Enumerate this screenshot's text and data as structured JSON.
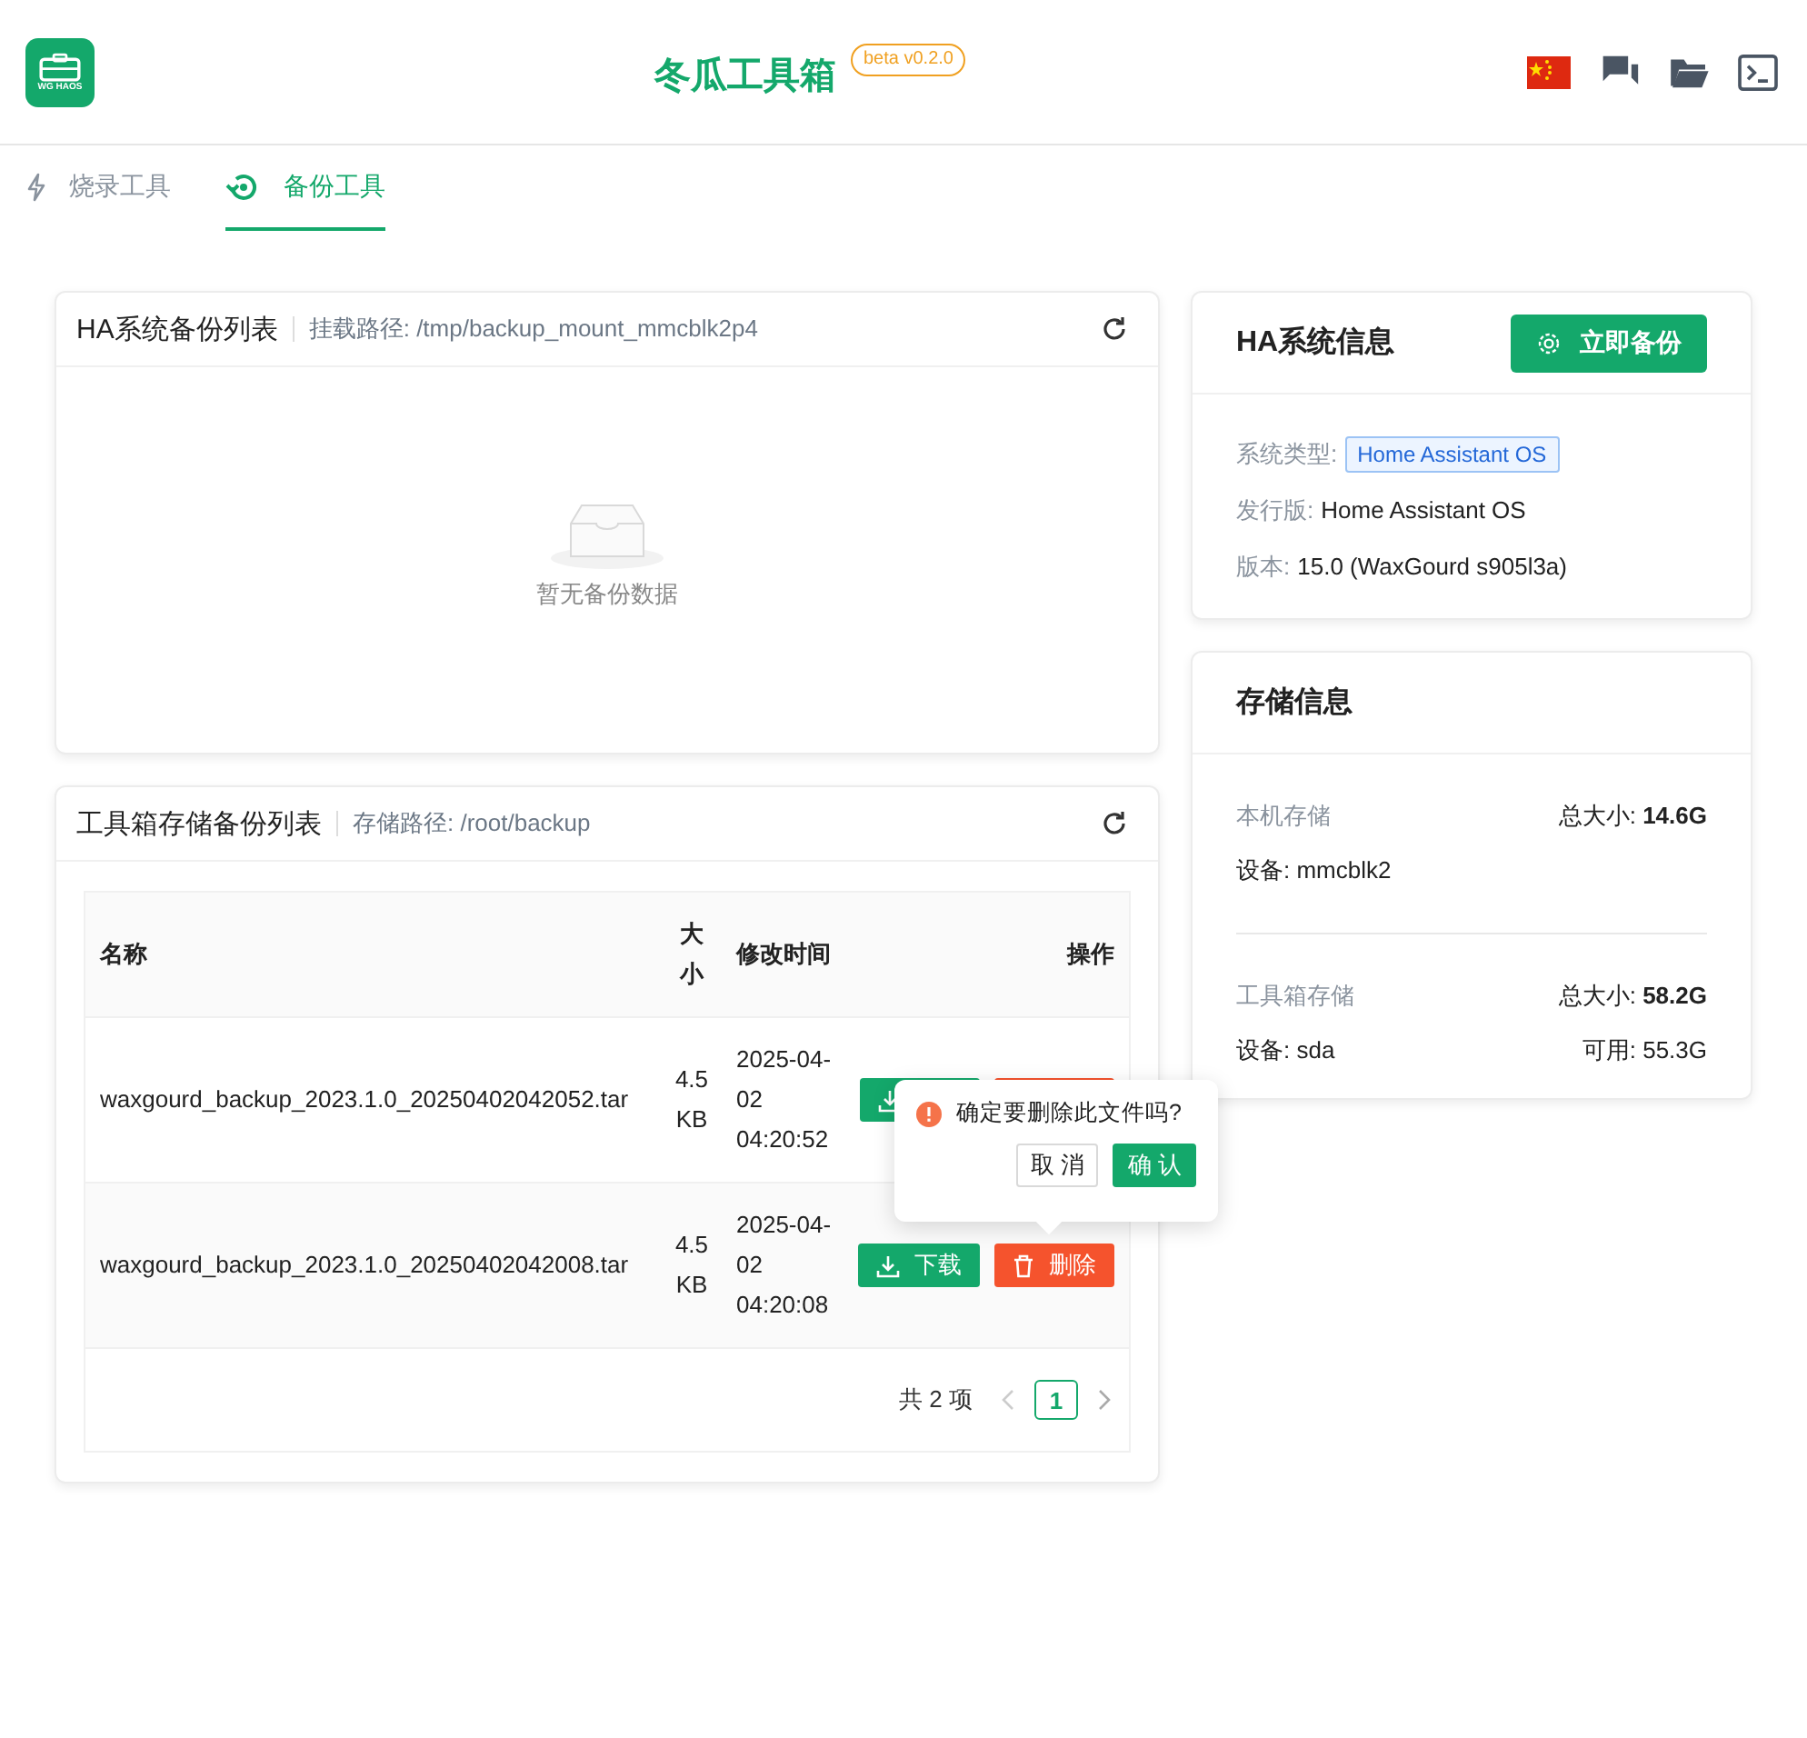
{
  "header": {
    "logo_text": "WG HAOS",
    "title": "冬瓜工具箱",
    "badge": "beta v0.2.0"
  },
  "tabs": [
    {
      "label": "烧录工具",
      "kind": "flash",
      "selected": false
    },
    {
      "label": "备份工具",
      "kind": "backup",
      "selected": true
    }
  ],
  "ha_backups": {
    "title": "HA系统备份列表",
    "path": "挂载路径: /tmp/backup_mount_mmcblk2p4",
    "empty_text": "暂无备份数据"
  },
  "toolbox_backups": {
    "title": "工具箱存储备份列表",
    "path": "存储路径: /root/backup",
    "columns": [
      "名称",
      "大小",
      "修改时间",
      "操作"
    ],
    "rows": [
      {
        "name": "waxgourd_backup_2023.1.0_20250402042052.tar",
        "size": "4.5 KB",
        "time": "2025-04-02 04:20:52",
        "actions": [
          {
            "kind": "download"
          },
          {
            "kind": "delete"
          }
        ]
      },
      {
        "name": "waxgourd_backup_2023.1.0_20250402042008.tar",
        "size": "4.5 KB",
        "time": "2025-04-02 04:20:08",
        "actions": [
          {
            "kind": "download",
            "label": "下载"
          },
          {
            "kind": "delete",
            "label": "删除"
          }
        ]
      }
    ],
    "total": "共 2 项",
    "pages": [
      {
        "label": "1",
        "selected": true
      }
    ],
    "popover": {
      "message": "确定要删除此文件吗?",
      "cancel": "取 消",
      "confirm": "确 认"
    }
  },
  "ha_info": {
    "title": "HA系统信息",
    "button": "立即备份",
    "fields": [
      {
        "label": "系统类型:",
        "value": "Home Assistant OS",
        "kind": "tag"
      },
      {
        "label": "发行版:",
        "value": "Home Assistant OS",
        "kind": "text"
      },
      {
        "label": "版本:",
        "value": "15.0 (WaxGourd s905l3a)",
        "kind": "text"
      }
    ]
  },
  "storage": {
    "title": "存储信息",
    "groups": [
      {
        "name": "本机存储",
        "total": "总大小: **14.6G**",
        "device": "设备: mmcblk2"
      },
      {
        "name": "工具箱存储",
        "total": "总大小: **58.2G**",
        "device": "设备: sda",
        "free": "可用: 55.3G"
      }
    ]
  }
}
